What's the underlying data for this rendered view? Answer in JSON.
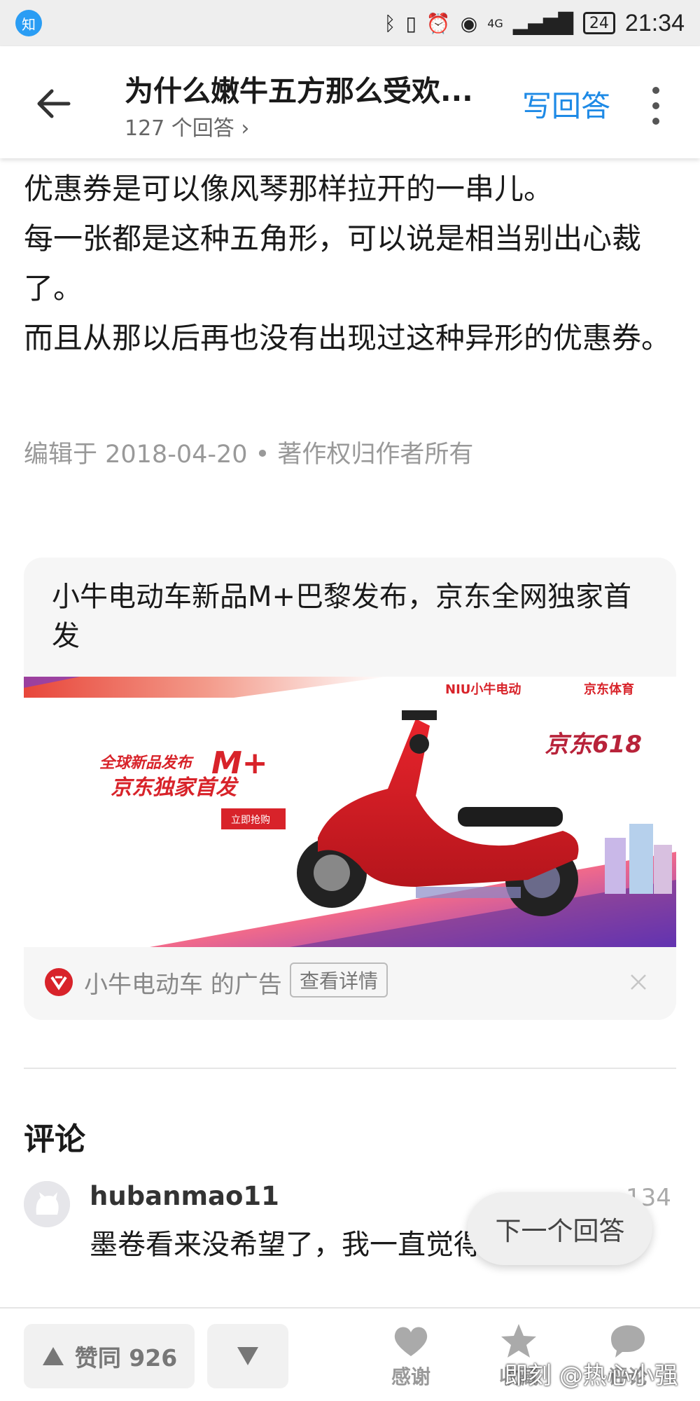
{
  "status_bar": {
    "app_badge": "知",
    "network": "4G",
    "battery": "24",
    "time": "21:34"
  },
  "header": {
    "title": "为什么嫩牛五方那么受欢...",
    "subtitle": "127 个回答 ›",
    "write_answer": "写回答"
  },
  "answer": {
    "paragraphs": [
      "优惠券是可以像风琴那样拉开的一串儿。",
      "每一张都是这种五角形，可以说是相当别出心裁了。",
      "而且从那以后再也没有出现过这种异形的优惠券。"
    ],
    "edit_meta": "编辑于 2018-04-20 • 著作权归作者所有"
  },
  "ad": {
    "title": "小牛电动车新品M+巴黎发布，京东全网独家首发",
    "banner": {
      "brand": "NIU小牛电动",
      "partner": "京东体育",
      "headline1": "全球新品发布",
      "model": "M+",
      "headline2": "京东独家首发",
      "cta": "立即抢购",
      "campaign": "京东618"
    },
    "sponsor": "小牛电动车 的广告",
    "detail_button": "查看详情",
    "colors": {
      "brand_red": "#d8232a"
    }
  },
  "comments": {
    "title": "评论",
    "items": [
      {
        "user": "hubanmao11",
        "likes": "134",
        "text": "墨卷看来没希望了，我一直觉得...好吃"
      }
    ]
  },
  "next_answer": "下一个回答",
  "bottom_bar": {
    "upvote": "赞同 926",
    "thanks": "感谢",
    "favorite": "收藏",
    "comment": "评论"
  },
  "watermark": "即刻 @热心小强",
  "colors": {
    "accent": "#1e8ae6"
  }
}
